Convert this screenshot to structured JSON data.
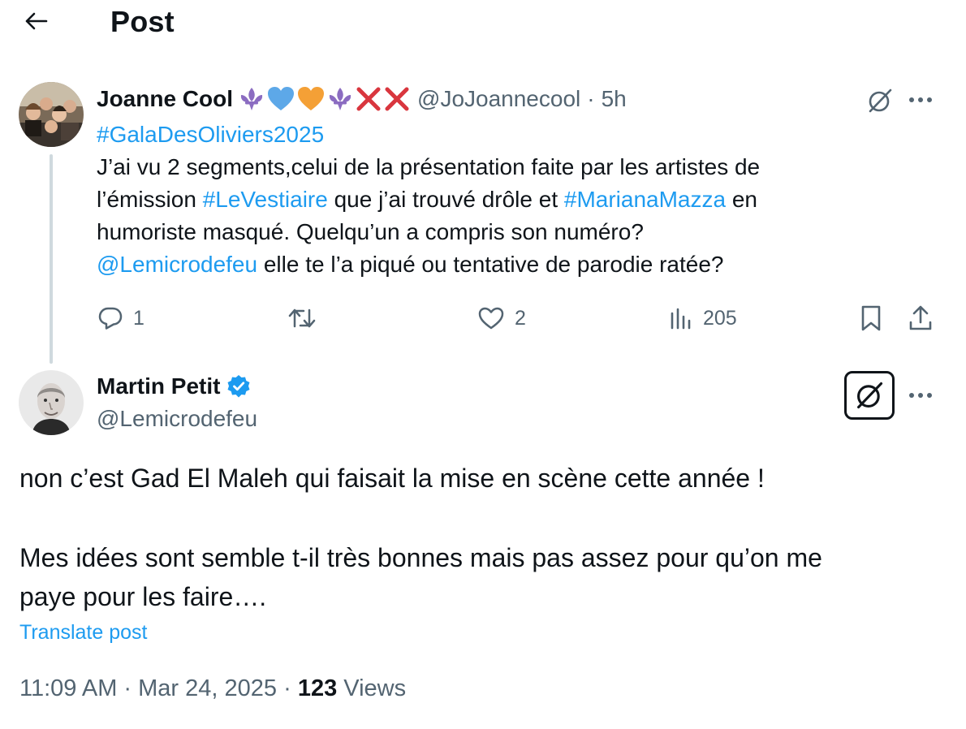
{
  "header": {
    "title": "Post"
  },
  "parent_post": {
    "display_name": "Joanne Cool",
    "name_emojis": [
      "fleur-de-lis-icon",
      "blue-heart-icon",
      "orange-heart-icon",
      "fleur-de-lis-icon",
      "cross-mark-icon",
      "cross-mark-icon"
    ],
    "handle": "@JoJoannecool",
    "separator": "·",
    "time": "5h",
    "text": {
      "hashtag_gala": "#GalaDesOliviers2025",
      "line2": "J’ai vu 2 segments,celui de la présentation faite par les artistes de",
      "line3_a": "l’émission ",
      "hashtag_vestiaire": "#LeVestiaire",
      "line3_b": " que j’ai trouvé drôle et ",
      "hashtag_mazza": "#MarianaMazza",
      "line3_c": " en",
      "line4": "humoriste masqué. Quelqu’un a compris son numéro?",
      "mention": "@Lemicrodefeu",
      "line5_b": " elle te l’a piqué ou tentative de parodie ratée?"
    },
    "actions": {
      "replies": "1",
      "reposts": "",
      "likes": "2",
      "views": "205"
    },
    "colors": {
      "link": "#1d9bf0",
      "muted": "#536471"
    }
  },
  "main_post": {
    "display_name": "Martin Petit",
    "verified": true,
    "handle": "@Lemicrodefeu",
    "paragraph1": "non c’est Gad El Maleh qui faisait la mise en scène cette année !",
    "paragraph2_line1": "Mes idées sont semble t-il très bonnes mais pas assez pour qu’on me",
    "paragraph2_line2": "paye pour les faire….",
    "translate_label": "Translate post",
    "timestamp": "11:09 AM · Mar 24, 2025",
    "meta_separator": "·",
    "views_count": "123",
    "views_label": "Views",
    "colors": {
      "verified": "#1d9bf0"
    }
  }
}
